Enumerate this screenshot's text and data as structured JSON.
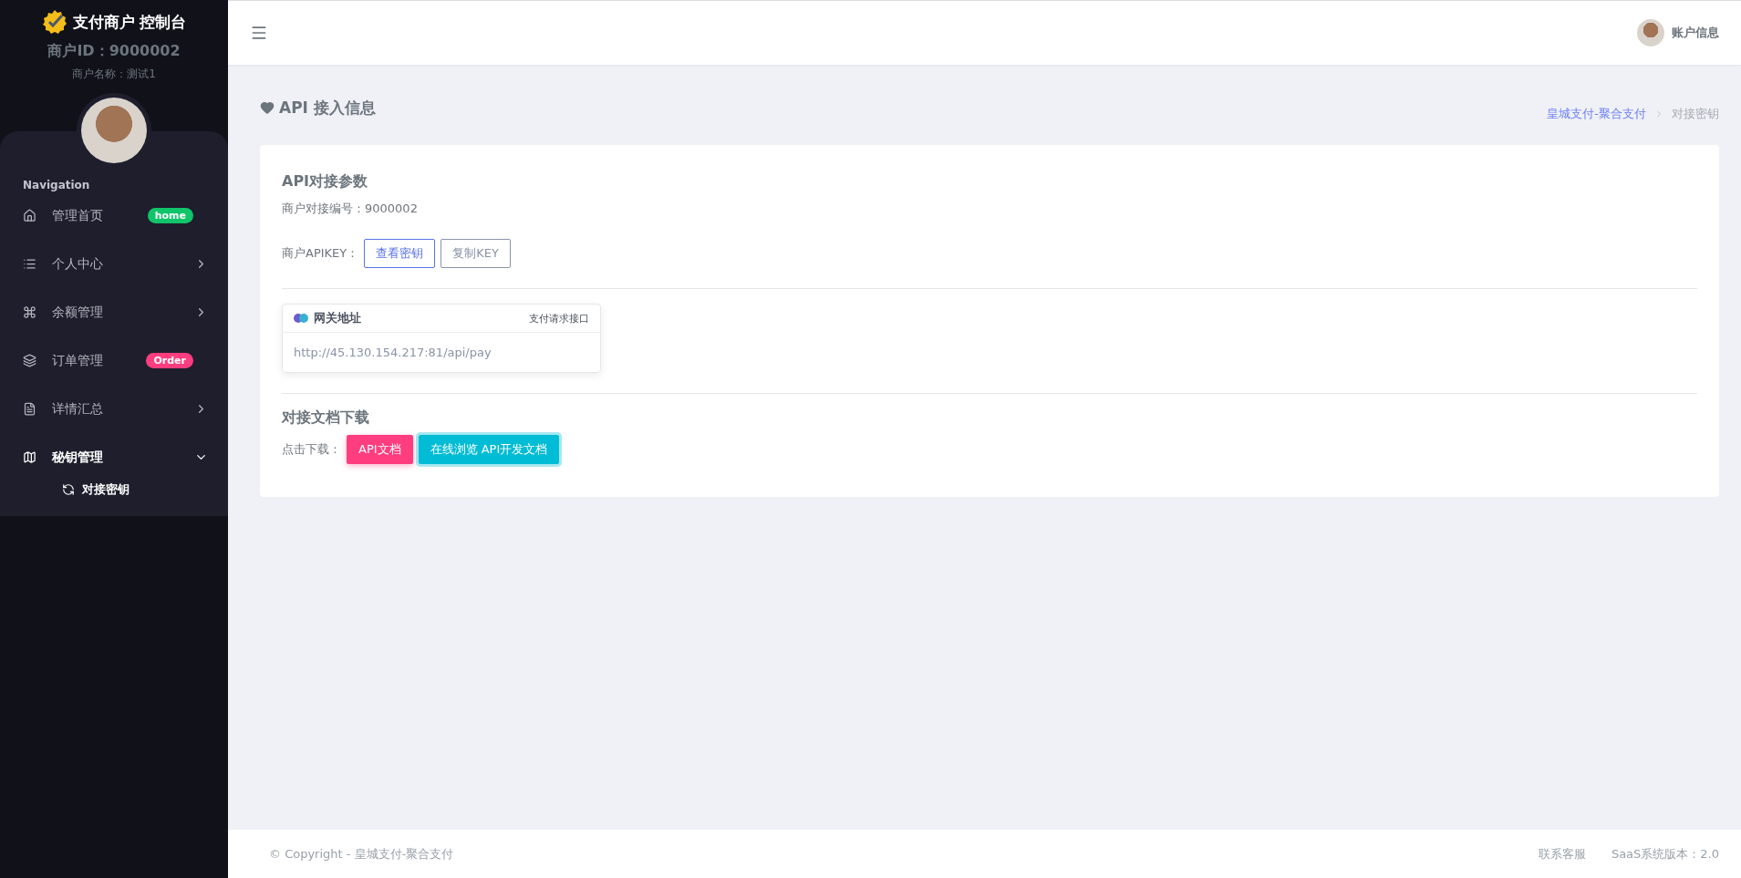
{
  "sidebar": {
    "brand": "支付商户 控制台",
    "merchant_id": "商户ID：9000002",
    "merchant_name": "商户名称：测试1",
    "nav_heading": "Navigation",
    "items": [
      {
        "kind": "link",
        "label": "管理首页",
        "selected": false,
        "badge": {
          "text": "home",
          "color": "#10c469"
        }
      },
      {
        "kind": "group",
        "label": "个人中心",
        "selected": false,
        "expanded": false
      },
      {
        "kind": "group",
        "label": "余额管理",
        "selected": false,
        "expanded": false
      },
      {
        "kind": "link",
        "label": "订单管理",
        "selected": false,
        "badge": {
          "text": "Order",
          "color": "#ff3d7f"
        }
      },
      {
        "kind": "group",
        "label": "详情汇总",
        "selected": false,
        "expanded": false
      },
      {
        "kind": "group",
        "label": "秘钥管理",
        "selected": true,
        "expanded": true,
        "children": [
          {
            "label": "对接密钥",
            "selected": true
          }
        ]
      }
    ]
  },
  "header": {
    "account": "账户信息"
  },
  "page": {
    "title": "API 接入信息",
    "breadcrumb": [
      {
        "label": "皇城支付-聚合支付",
        "kind": "link"
      },
      {
        "label": "对接密钥",
        "kind": "current"
      }
    ]
  },
  "params": {
    "heading": "API对接参数",
    "merchant_no": "商户对接编号：9000002",
    "apikey_label": "商户APIKEY：",
    "buttons": [
      {
        "label": "查看密钥",
        "kind": "primary"
      },
      {
        "label": "复制KEY",
        "kind": "secondary"
      }
    ]
  },
  "gateway": {
    "title": "网关地址",
    "note": "支付请求接口",
    "url": "http://45.130.154.217:81/api/pay"
  },
  "docs": {
    "heading": "对接文档下载",
    "label": "点击下载：",
    "buttons": [
      {
        "label": "API文档",
        "kind": "pink"
      },
      {
        "label": "在线浏览 API开发文档",
        "kind": "cyan"
      }
    ]
  },
  "footer": {
    "copyright": "© Copyright - 皇城支付-聚合支付",
    "links": [
      "联系客服",
      "SaaS系统版本：2.0"
    ]
  }
}
